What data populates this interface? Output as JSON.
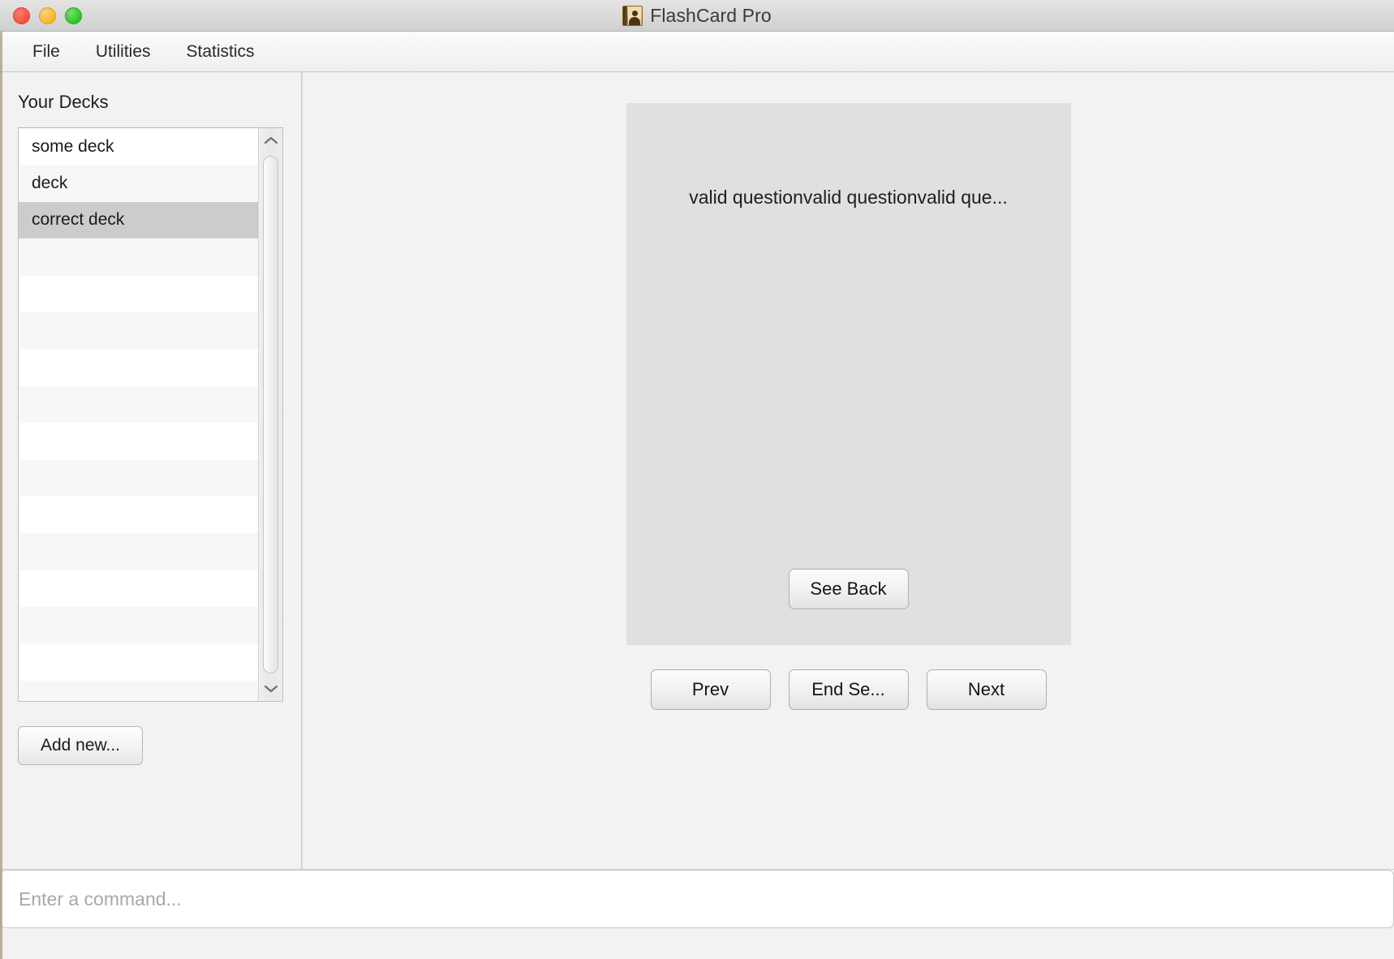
{
  "window": {
    "title": "FlashCard Pro",
    "app_icon": "address-book-icon",
    "traffic_lights": {
      "close": "close-window-button",
      "minimize": "minimize-window-button",
      "maximize": "maximize-window-button"
    },
    "colors": {
      "close": "#f4523f",
      "minimize": "#f9b528",
      "maximize": "#2dc42a",
      "card_background": "#e0e0e0",
      "selected_row": "#cccccc",
      "panel_background": "#f2f2f2"
    }
  },
  "menubar": {
    "items": [
      {
        "label": "File"
      },
      {
        "label": "Utilities"
      },
      {
        "label": "Statistics"
      }
    ]
  },
  "sidebar": {
    "heading": "Your Decks",
    "decks": [
      {
        "label": "some deck",
        "selected": false
      },
      {
        "label": "deck",
        "selected": false
      },
      {
        "label": "correct deck",
        "selected": true
      },
      {
        "label": "",
        "selected": false
      },
      {
        "label": "",
        "selected": false
      },
      {
        "label": "",
        "selected": false
      },
      {
        "label": "",
        "selected": false
      },
      {
        "label": "",
        "selected": false
      },
      {
        "label": "",
        "selected": false
      },
      {
        "label": "",
        "selected": false
      },
      {
        "label": "",
        "selected": false
      },
      {
        "label": "",
        "selected": false
      },
      {
        "label": "",
        "selected": false
      },
      {
        "label": "",
        "selected": false
      },
      {
        "label": "",
        "selected": false
      },
      {
        "label": "",
        "selected": false
      }
    ],
    "scrollbar": {
      "up_arrow": "chevron-up-icon",
      "down_arrow": "chevron-down-icon"
    },
    "add_new_label": "Add new..."
  },
  "card": {
    "question": "valid questionvalid questionvalid que...",
    "see_back_label": "See Back"
  },
  "navigation": {
    "prev_label": "Prev",
    "end_session_label": "End Se...",
    "next_label": "Next"
  },
  "command": {
    "value": "",
    "placeholder": "Enter a command..."
  }
}
